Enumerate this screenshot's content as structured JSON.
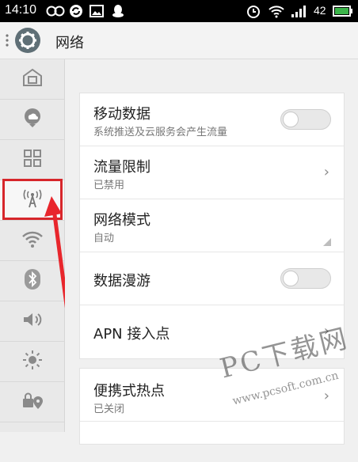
{
  "status_bar": {
    "time": "14:10",
    "battery_level": "42",
    "icons": [
      "infinity-icon",
      "sync-icon",
      "image-icon",
      "qq-icon",
      "alarm-icon",
      "wifi-icon",
      "signal-icon",
      "battery-icon"
    ]
  },
  "header": {
    "title": "网络",
    "icon": "gear-icon"
  },
  "sidebar": {
    "items": [
      {
        "icon": "home-icon"
      },
      {
        "icon": "cloud-icon"
      },
      {
        "icon": "apps-grid-icon"
      },
      {
        "icon": "antenna-icon",
        "selected": true
      },
      {
        "icon": "wifi-icon"
      },
      {
        "icon": "bluetooth-icon"
      },
      {
        "icon": "volume-icon"
      },
      {
        "icon": "brightness-icon"
      },
      {
        "icon": "lock-location-icon"
      }
    ]
  },
  "settings": {
    "mobile_data": {
      "title": "移动数据",
      "subtitle": "系统推送及云服务会产生流量",
      "enabled": false
    },
    "data_limit": {
      "title": "流量限制",
      "subtitle": "已禁用"
    },
    "network_mode": {
      "title": "网络模式",
      "subtitle": "自动"
    },
    "data_roaming": {
      "title": "数据漫游",
      "enabled": false
    },
    "apn": {
      "title": "APN 接入点"
    },
    "hotspot": {
      "title": "便携式热点",
      "subtitle": "已关闭"
    }
  },
  "watermark": {
    "text": "PC下载网",
    "url": "www.pcsoft.com.cn"
  },
  "colors": {
    "highlight": "#d7262b",
    "status_bar_bg": "#000000"
  }
}
